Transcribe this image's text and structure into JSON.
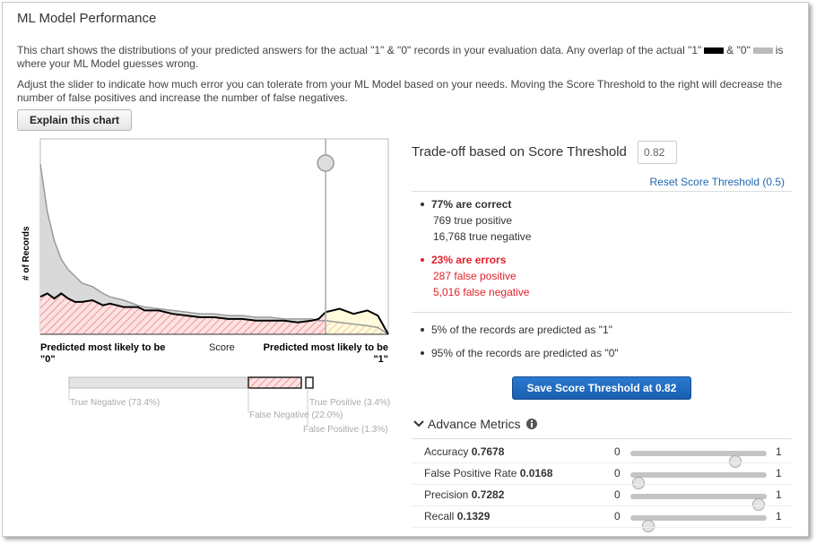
{
  "title": "ML Model Performance",
  "intro": {
    "line1_a": "This chart shows the distributions of your predicted answers for the actual \"1\" & \"0\" records in your evaluation data. Any overlap of the actual \"1\"",
    "line1_b": "& \"0\"",
    "line1_c": "is",
    "line2": "where your ML Model guesses wrong.",
    "adjust": "Adjust the slider to indicate how much error you can tolerate from your ML Model based on your needs. Moving the Score Threshold to the right will decrease the number of false positives and increase the number of false negatives."
  },
  "explain_button": "Explain this chart",
  "chart": {
    "ylabel": "# of Records",
    "xlabel": "Score",
    "left_label_1": "Predicted most likely to be",
    "left_label_2": "\"0\"",
    "right_label_1": "Predicted most likely to be",
    "right_label_2": "\"1\""
  },
  "chart_data": {
    "type": "area",
    "xlabel": "Score",
    "ylabel": "# of Records",
    "xlim": [
      0,
      1
    ],
    "threshold": 0.82,
    "series": [
      {
        "name": "actual 0",
        "color": "#bdbdbd",
        "x": [
          0.0,
          0.02,
          0.04,
          0.06,
          0.08,
          0.1,
          0.12,
          0.15,
          0.18,
          0.2,
          0.24,
          0.28,
          0.3,
          0.34,
          0.38,
          0.42,
          0.46,
          0.5,
          0.54,
          0.58,
          0.62,
          0.66,
          0.7,
          0.74,
          0.78,
          0.8,
          0.82,
          0.86,
          0.9,
          0.94,
          0.97,
          1.0
        ],
        "y": [
          100,
          72,
          55,
          44,
          38,
          34,
          30,
          28,
          24,
          22,
          20,
          17,
          16,
          15,
          14,
          13,
          12,
          12,
          11,
          11,
          10,
          10,
          9,
          9,
          9,
          8,
          8,
          7,
          6,
          5,
          4,
          0
        ]
      },
      {
        "name": "actual 1",
        "color": "#000000",
        "x": [
          0.0,
          0.02,
          0.04,
          0.06,
          0.08,
          0.1,
          0.12,
          0.15,
          0.18,
          0.2,
          0.24,
          0.28,
          0.3,
          0.34,
          0.38,
          0.42,
          0.46,
          0.5,
          0.54,
          0.58,
          0.62,
          0.66,
          0.7,
          0.74,
          0.78,
          0.8,
          0.82,
          0.86,
          0.9,
          0.94,
          0.97,
          1.0
        ],
        "y": [
          22,
          24,
          21,
          24,
          21,
          19,
          19,
          20,
          17,
          18,
          16,
          16,
          14,
          14,
          12,
          11,
          10,
          10,
          9,
          9,
          8,
          8,
          8,
          7,
          8,
          9,
          13,
          15,
          12,
          14,
          11,
          0
        ]
      }
    ]
  },
  "bar": {
    "true_negative": "True Negative (73.4%)",
    "false_negative": "False Negative (22.0%)",
    "true_positive": "True Positive (3.4%)",
    "false_positive": "False Positive (1.3%)",
    "tn_pct": 73.4,
    "fn_pct": 22.0,
    "tp_pct": 3.4,
    "fp_pct": 1.3
  },
  "tradeoff": {
    "title": "Trade-off based on Score Threshold",
    "threshold_value": "0.82",
    "reset_label": "Reset Score Threshold (0.5)",
    "correct_title": "77% are correct",
    "true_positive": "769 true positive",
    "true_negative": "16,768 true negative",
    "errors_title": "23% are errors",
    "false_positive": "287 false positive",
    "false_negative": "5,016 false negative",
    "pred_1": "5% of the records are predicted as \"1\"",
    "pred_0": "95% of the records are predicted as \"0\"",
    "save_button": "Save Score Threshold at 0.82"
  },
  "advance": {
    "title": "Advance Metrics",
    "min_label": "0",
    "max_label": "1",
    "metrics": [
      {
        "name": "Accuracy",
        "value": "0.7678",
        "level": 0.7678
      },
      {
        "name": "False Positive Rate",
        "value": "0.0168",
        "level": 0.0168
      },
      {
        "name": "Precision",
        "value": "0.7282",
        "level": 0.98
      },
      {
        "name": "Recall",
        "value": "0.1329",
        "level": 0.1329
      }
    ]
  },
  "colors": {
    "accent": "#1f68b0",
    "error": "#e0202a",
    "save": "#1a5fae",
    "negative_fill": "#d9d9d9",
    "positive_fill": "#fffbdc"
  }
}
